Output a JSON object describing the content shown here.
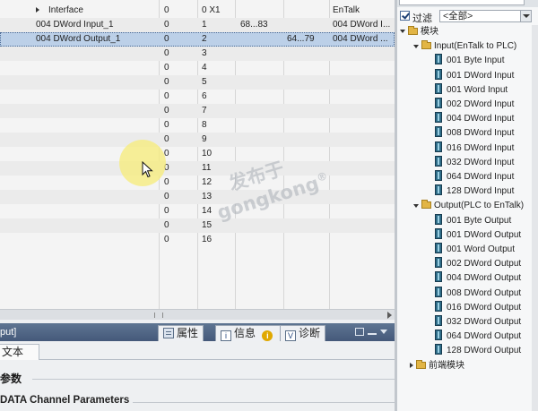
{
  "table": {
    "rows": [
      {
        "name": "Interface",
        "rack": "0",
        "slot": "0 X1",
        "i_address": "",
        "q_address": "",
        "type": "EnTalk",
        "expandable": true,
        "selected": false
      },
      {
        "name": "004 DWord Input_1",
        "rack": "0",
        "slot": "1",
        "i_address": "68...83",
        "q_address": "",
        "type": "004 DWord I...",
        "expandable": false,
        "selected": false
      },
      {
        "name": "004 DWord Output_1",
        "rack": "0",
        "slot": "2",
        "i_address": "",
        "q_address": "64...79",
        "type": "004 DWord ...",
        "expandable": false,
        "selected": true
      },
      {
        "name": "",
        "rack": "0",
        "slot": "3",
        "i_address": "",
        "q_address": "",
        "type": ""
      },
      {
        "name": "",
        "rack": "0",
        "slot": "4",
        "i_address": "",
        "q_address": "",
        "type": ""
      },
      {
        "name": "",
        "rack": "0",
        "slot": "5",
        "i_address": "",
        "q_address": "",
        "type": ""
      },
      {
        "name": "",
        "rack": "0",
        "slot": "6",
        "i_address": "",
        "q_address": "",
        "type": ""
      },
      {
        "name": "",
        "rack": "0",
        "slot": "7",
        "i_address": "",
        "q_address": "",
        "type": ""
      },
      {
        "name": "",
        "rack": "0",
        "slot": "8",
        "i_address": "",
        "q_address": "",
        "type": ""
      },
      {
        "name": "",
        "rack": "0",
        "slot": "9",
        "i_address": "",
        "q_address": "",
        "type": ""
      },
      {
        "name": "",
        "rack": "0",
        "slot": "10",
        "i_address": "",
        "q_address": "",
        "type": ""
      },
      {
        "name": "",
        "rack": "0",
        "slot": "11",
        "i_address": "",
        "q_address": "",
        "type": ""
      },
      {
        "name": "",
        "rack": "0",
        "slot": "12",
        "i_address": "",
        "q_address": "",
        "type": ""
      },
      {
        "name": "",
        "rack": "0",
        "slot": "13",
        "i_address": "",
        "q_address": "",
        "type": ""
      },
      {
        "name": "",
        "rack": "0",
        "slot": "14",
        "i_address": "",
        "q_address": "",
        "type": ""
      },
      {
        "name": "",
        "rack": "0",
        "slot": "15",
        "i_address": "",
        "q_address": "",
        "type": ""
      },
      {
        "name": "",
        "rack": "0",
        "slot": "16",
        "i_address": "",
        "q_address": "",
        "type": ""
      }
    ]
  },
  "inspector": {
    "title": "put]",
    "tabs": {
      "properties": "属性",
      "info": "信息",
      "diagnostics": "诊断"
    },
    "subtab_text": "文本",
    "params_heading": "参数",
    "channel_heading": "DATA Channel Parameters"
  },
  "catalog": {
    "filter_label": "过滤",
    "filter_value": "<全部>",
    "root": "模块",
    "groups": [
      {
        "label": "Input(EnTalk to PLC)",
        "items": [
          "001 Byte Input",
          "001 DWord Input",
          "001 Word Input",
          "002 DWord Input",
          "004 DWord Input",
          "008 DWord Input",
          "016 DWord Input",
          "032 DWord Input",
          "064 DWord Input",
          "128 DWord Input"
        ]
      },
      {
        "label": "Output(PLC to EnTalk)",
        "items": [
          "001 Byte Output",
          "001 DWord Output",
          "001 Word Output",
          "002 DWord Output",
          "004 DWord Output",
          "008 DWord Output",
          "016 DWord Output",
          "032 DWord Output",
          "064 DWord Output",
          "128 DWord Output"
        ]
      }
    ],
    "collapsed_group": "前端模块"
  },
  "watermark": {
    "line1": "发布于",
    "line2": "gongkong",
    "mark": "®"
  },
  "colors": {
    "selection": "#bcd0e8",
    "inspector_header": "#4f6584",
    "module_icon": "#2f6d88",
    "folder_icon": "#e2b545",
    "highlight": "#f7ec78"
  }
}
